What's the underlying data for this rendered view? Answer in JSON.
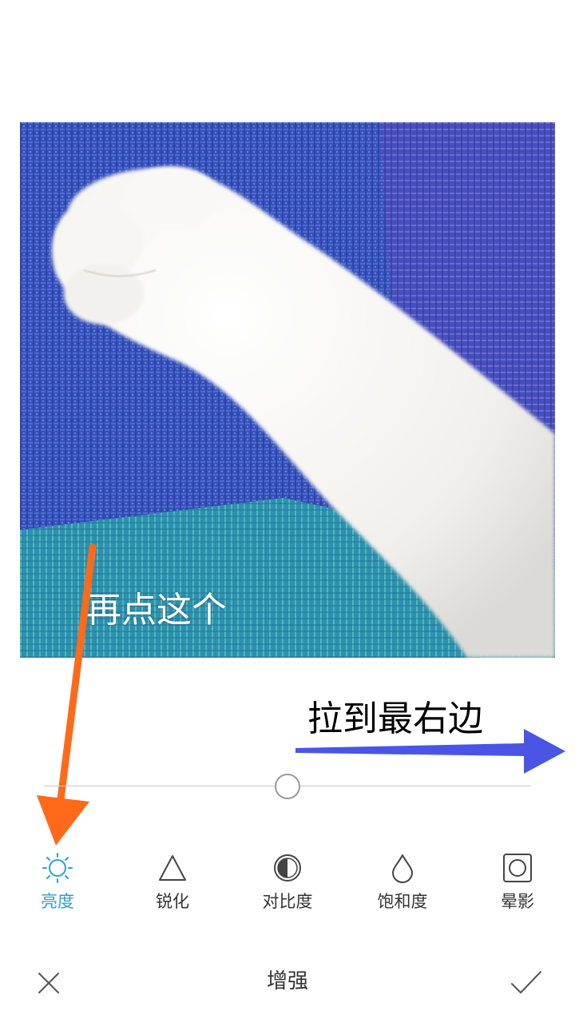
{
  "photo": {
    "description_icon": "cat-paw-photo"
  },
  "annotations": {
    "tap_hint": "再点这个",
    "drag_hint": "拉到最右边",
    "tap_arrow_color": "#ff6a1a",
    "drag_arrow_color": "#4a55e6"
  },
  "slider": {
    "value_fraction": 0.5
  },
  "tools": [
    {
      "label": "亮度",
      "icon": "sun-icon",
      "active": true
    },
    {
      "label": "锐化",
      "icon": "triangle-icon",
      "active": false
    },
    {
      "label": "对比度",
      "icon": "half-circle-icon",
      "active": false
    },
    {
      "label": "饱和度",
      "icon": "droplet-icon",
      "active": false
    },
    {
      "label": "晕影",
      "icon": "vignette-icon",
      "active": false
    }
  ],
  "bottom_bar": {
    "title": "增强",
    "close_icon": "close-icon",
    "confirm_icon": "check-icon"
  },
  "colors": {
    "accent": "#2a9fd6",
    "text": "#333333",
    "icon": "#444444"
  }
}
